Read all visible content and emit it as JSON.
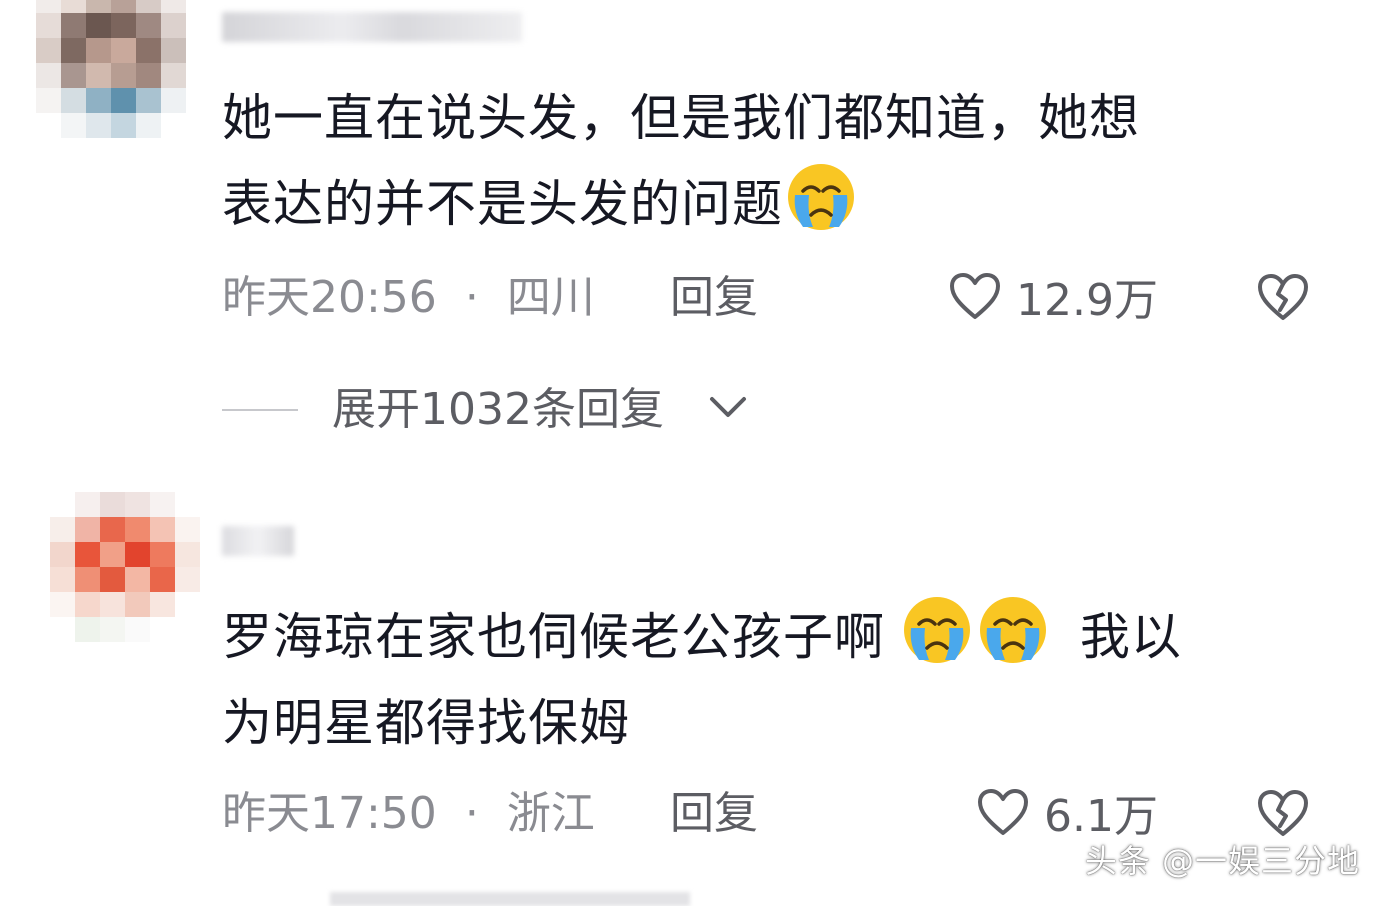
{
  "comments": [
    {
      "text_line1": "她一直在说头发，但是我们都知道，她想",
      "text_line2": "表达的并不是头发的问题",
      "time": "昨天20:56",
      "separator": "·",
      "location": "四川",
      "reply_label": "回复",
      "likes": "12.9万",
      "emoji": "crying-face"
    },
    {
      "text_line1": "罗海琼在家也伺候老公孩子啊",
      "text_line1_tail": "我以",
      "text_line2": "为明星都得找保姆",
      "time": "昨天17:50",
      "separator": "·",
      "location": "浙江",
      "reply_label": "回复",
      "likes": "6.1万",
      "emoji": "crying-face"
    }
  ],
  "expand": {
    "label": "展开1032条回复"
  },
  "watermark": "头条 @一娱三分地",
  "colors": {
    "text": "#161823",
    "meta": "#8a8b91",
    "action": "#5c5d63",
    "emoji_face": "#f9c623",
    "emoji_tear": "#4aa8ec"
  }
}
